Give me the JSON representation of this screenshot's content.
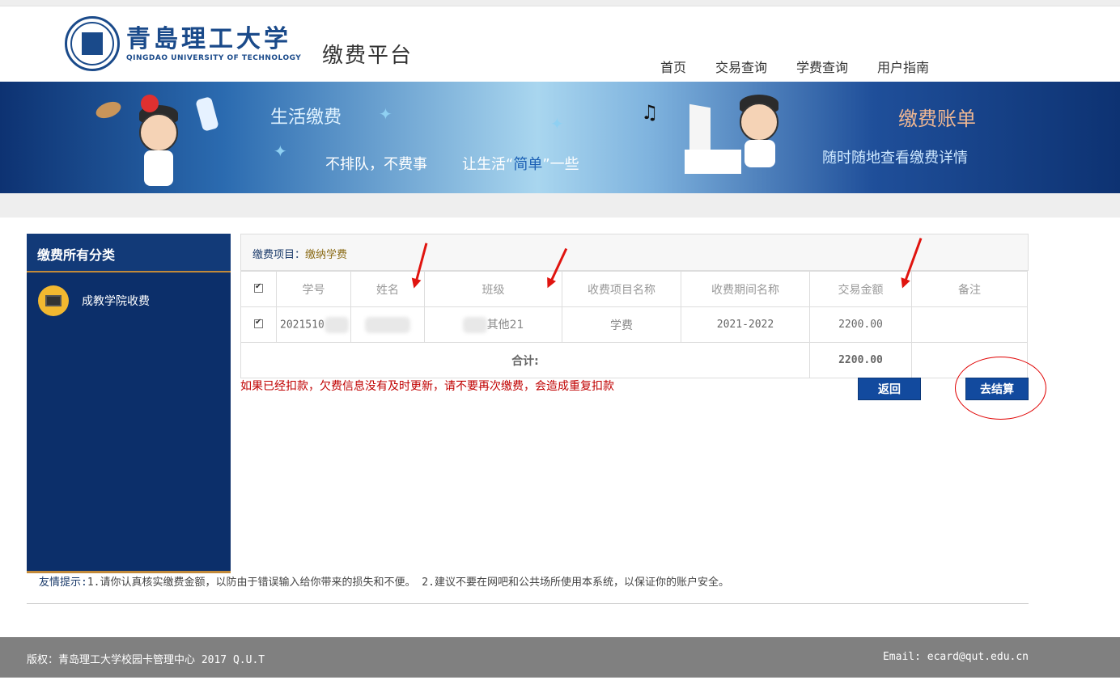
{
  "header": {
    "logo_cn": "青島理工大学",
    "logo_en": "QINGDAO UNIVERSITY OF TECHNOLOGY",
    "platform": "缴费平台",
    "nav": [
      "首页",
      "交易查询",
      "学费查询",
      "用户指南"
    ]
  },
  "banner": {
    "life_pay": "生活缴费",
    "no_queue": "不排队，不费事",
    "simple_prefix": "让生活“",
    "simple_word": "简单",
    "simple_suffix": "”一些",
    "bill": "缴费账单",
    "bill_sub": "随时随地查看缴费详情"
  },
  "sidebar": {
    "title": "缴费所有分类",
    "items": [
      "成教学院收费"
    ]
  },
  "panel": {
    "item_label": "缴费项目：",
    "item_value": "缴纳学费",
    "columns": [
      "学号",
      "姓名",
      "班级",
      "收费项目名称",
      "收费期间名称",
      "交易金额",
      "备注"
    ],
    "rows": [
      {
        "student_id": "2021510",
        "name": "",
        "class": "其他21",
        "item": "学费",
        "period": "2021-2022",
        "amount": "2200.00",
        "note": ""
      }
    ],
    "total_label": "合计:",
    "total_amount": "2200.00"
  },
  "warning": "如果已经扣款，欠费信息没有及时更新，请不要再次缴费，会造成重复扣款",
  "buttons": {
    "back": "返回",
    "checkout": "去结算"
  },
  "tips": {
    "label": "友情提示:",
    "text": "1.请你认真核实缴费金额，以防由于错误输入给你带来的损失和不便。   2.建议不要在网吧和公共场所使用本系统，以保证你的账户安全。"
  },
  "footer": {
    "copyright": "版权：青岛理工大学校园卡管理中心 2017 Q.U.T",
    "email": "Email: ecard@qut.edu.cn"
  },
  "colors": {
    "navy": "#0c2f6a",
    "button": "#124a9e",
    "warning": "#c00000",
    "footer": "#808080"
  }
}
